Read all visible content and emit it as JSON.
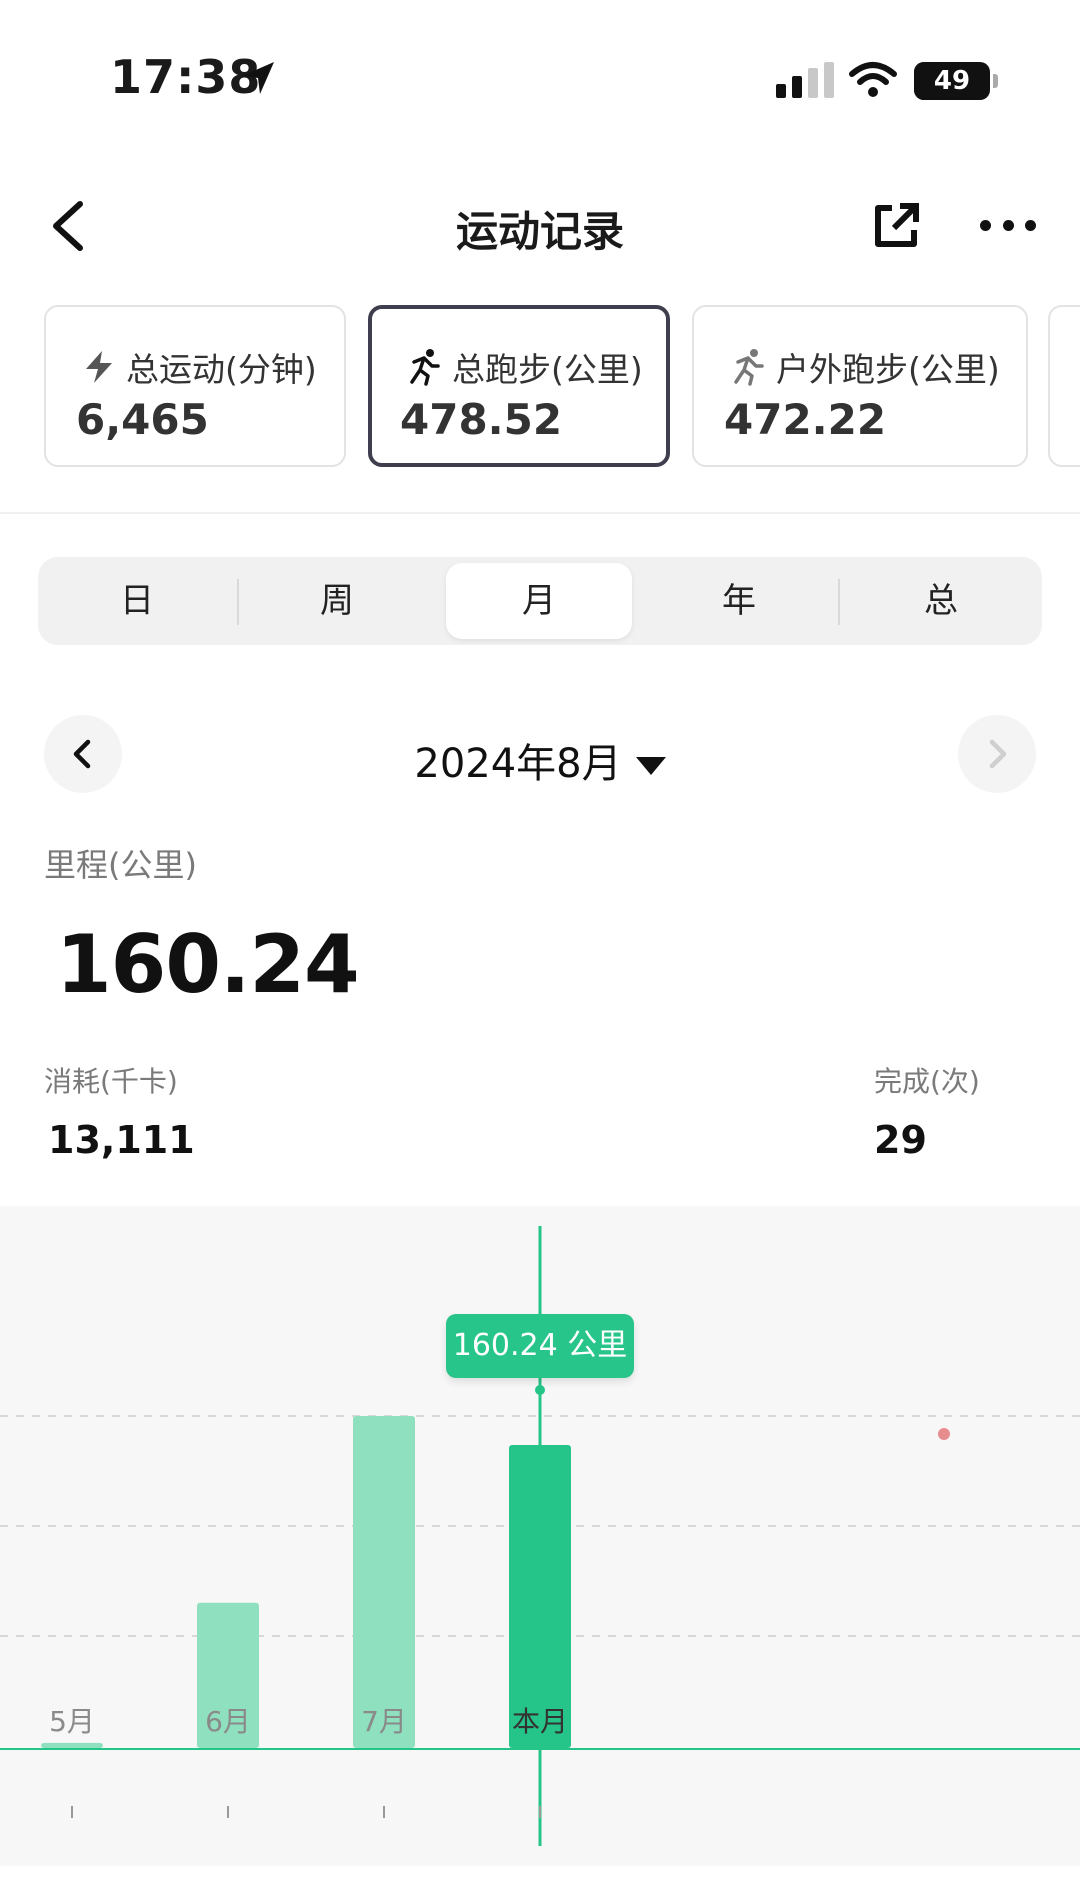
{
  "status": {
    "time": "17:38",
    "battery": "49",
    "battery_level": 49
  },
  "nav": {
    "title": "运动记录"
  },
  "cards": [
    {
      "label": "总运动(分钟)",
      "value": "6,465",
      "icon": "lightning-icon"
    },
    {
      "label": "总跑步(公里)",
      "value": "478.52",
      "icon": "runner-icon"
    },
    {
      "label": "户外跑步(公里)",
      "value": "472.22",
      "icon": "outdoor-runner-icon"
    }
  ],
  "segments": [
    "日",
    "周",
    "月",
    "年",
    "总"
  ],
  "selected_segment": "月",
  "period": {
    "label": "2024年8月"
  },
  "stats": {
    "distance_label": "里程(公里)",
    "distance_value": "160.24",
    "calorie_label": "消耗(千卡)",
    "calorie_value": "13,111",
    "count_label": "完成(次)",
    "count_value": "29"
  },
  "chart_data": {
    "type": "bar",
    "categories": [
      "5月",
      "6月",
      "7月",
      "本月"
    ],
    "values": [
      2.5,
      70,
      160,
      146
    ],
    "highlighted": "本月",
    "tooltip": "160.24 公里",
    "ylim": [
      0,
      160
    ],
    "grid": true,
    "colors": {
      "bar": "#8fe0bf",
      "bar_active": "#25c589",
      "tooltip": "#27c58a"
    }
  }
}
